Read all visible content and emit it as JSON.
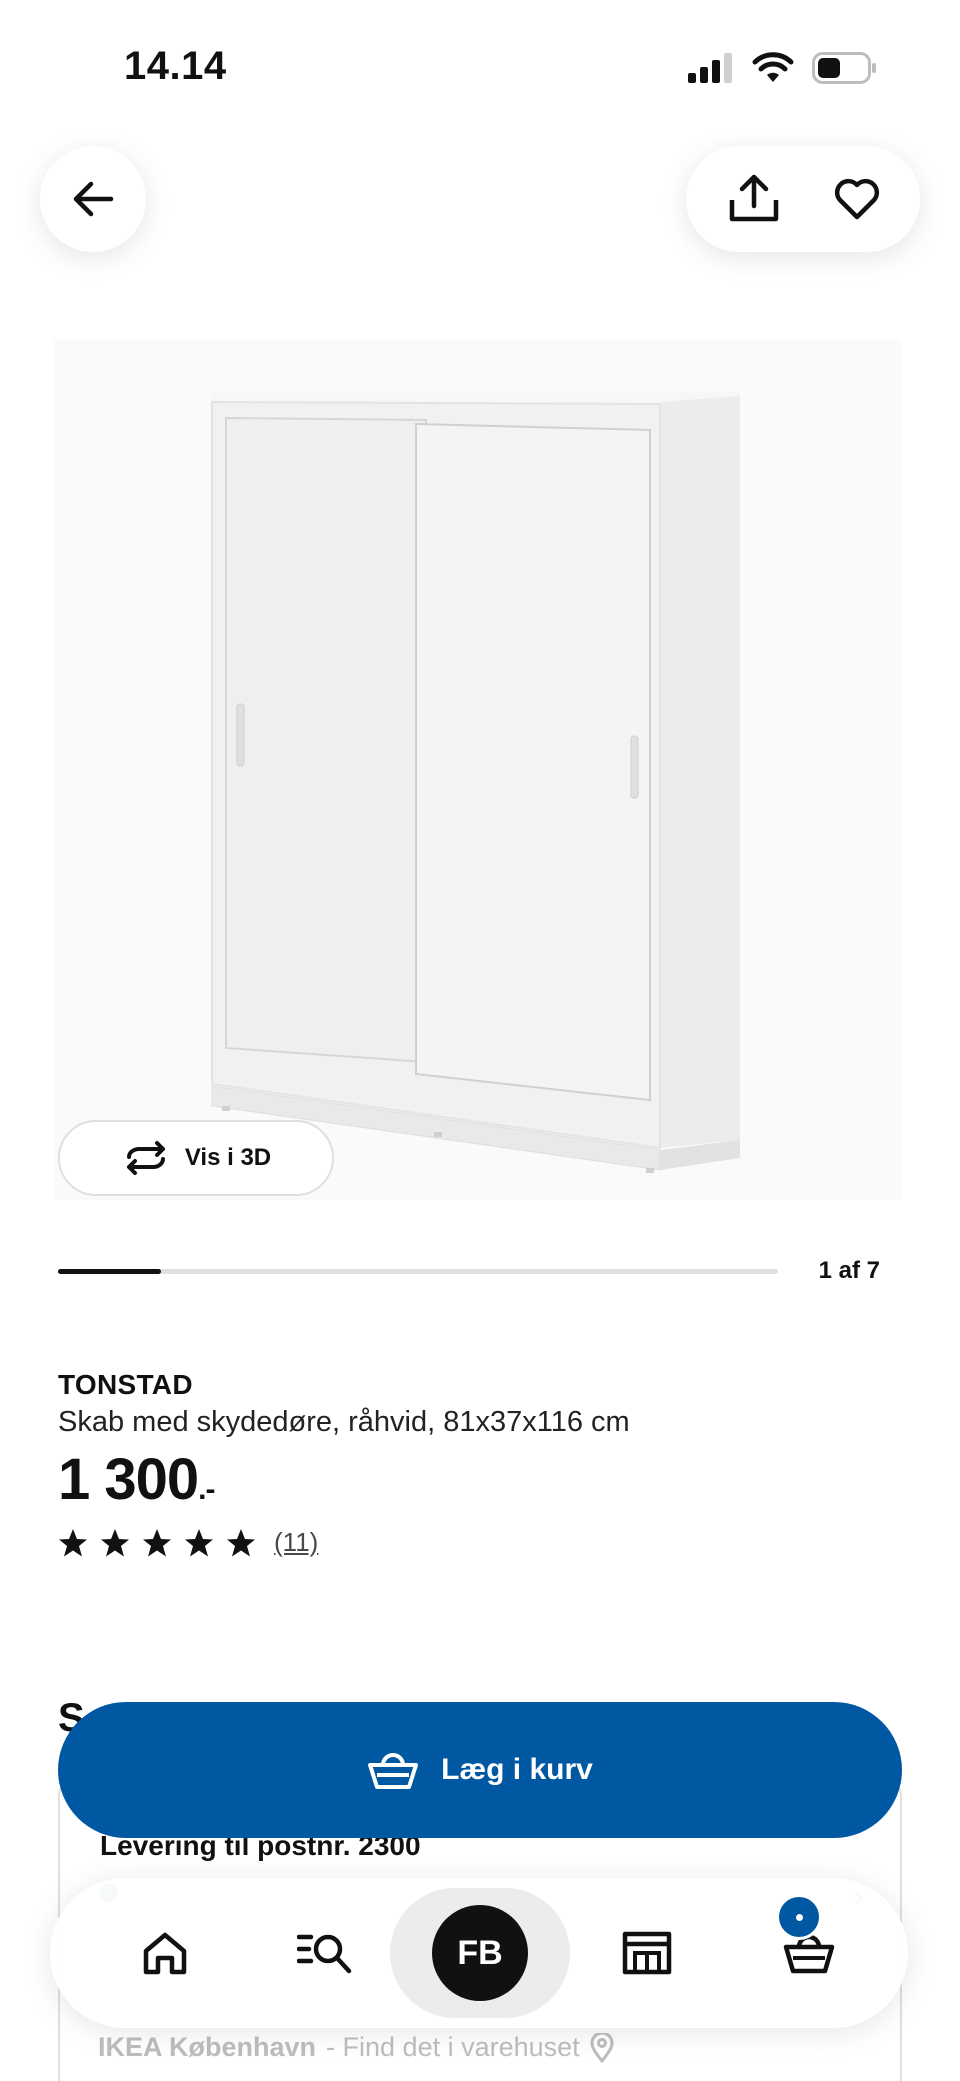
{
  "status_bar": {
    "time": "14.14"
  },
  "gallery": {
    "vis3d_label": "Vis i 3D",
    "progress_label": "1 af 7",
    "current": 1,
    "total": 7
  },
  "product": {
    "name": "TONSTAD",
    "description": "Skab med skydedøre, råhvid, 81x37x116 cm",
    "price": "1 300",
    "price_suffix": ".-",
    "rating_stars": 5,
    "rating_count": "(11)"
  },
  "section": {
    "heading_partial": "S",
    "delivery_title": "Levering til postnr. 2300",
    "store_name": "IKEA København",
    "store_link": "- Find det i varehuset"
  },
  "cart_button": {
    "label": "Læg i kurv"
  },
  "bottom_nav": {
    "items": [
      "home-icon",
      "search-icon",
      "FB",
      "stores-icon",
      "cart-icon"
    ],
    "fb_label": "FB"
  },
  "colors": {
    "primary_blue": "#0058a3",
    "text": "#111111",
    "green_dot": "#0a8a00"
  }
}
